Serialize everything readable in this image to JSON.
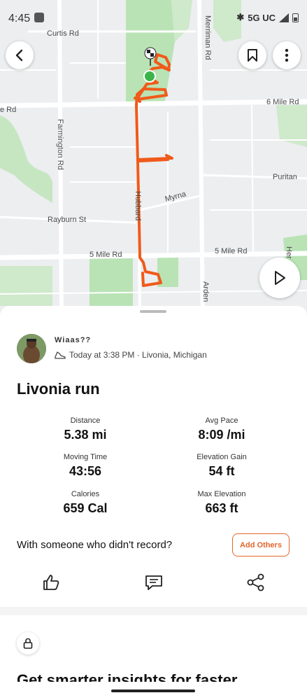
{
  "status_bar": {
    "time": "4:45",
    "network": "5G UC"
  },
  "map": {
    "roads": {
      "curtis": "Curtis Rd",
      "merriman": "Merriman Rd",
      "six_mile_right": "6 Mile Rd",
      "six_mile_left": "e Rd",
      "farmington": "Farmington Rd",
      "puritan": "Puritan",
      "myrna": "Myrna",
      "rayburn": "Rayburn St",
      "hubbard": "Hubbard",
      "five_mile_left": "5 Mile Rd",
      "five_mile_right": "5 Mile Rd",
      "arden": "Arden",
      "henry": "Her"
    },
    "route_color": "#f05a1a",
    "park_color": "#b9e3b5"
  },
  "activity": {
    "athlete": "Wiaas??",
    "meta": "Today at 3:38 PM · Livonia, Michigan",
    "title": "Livonia run",
    "stats": [
      {
        "label": "Distance",
        "value": "5.38 mi"
      },
      {
        "label": "Avg Pace",
        "value": "8:09 /mi"
      },
      {
        "label": "Moving Time",
        "value": "43:56"
      },
      {
        "label": "Elevation Gain",
        "value": "54 ft"
      },
      {
        "label": "Calories",
        "value": "659 Cal"
      },
      {
        "label": "Max Elevation",
        "value": "663 ft"
      }
    ],
    "prompt": "With someone who didn't record?",
    "add_others": "Add Others"
  },
  "insights": {
    "heading": "Get smarter insights for faster"
  },
  "icons": [
    "back-icon",
    "bookmark-icon",
    "more-icon",
    "play-icon",
    "shoe-icon",
    "like-icon",
    "comment-icon",
    "share-icon",
    "lock-icon"
  ],
  "colors": {
    "accent": "#e2652b"
  }
}
